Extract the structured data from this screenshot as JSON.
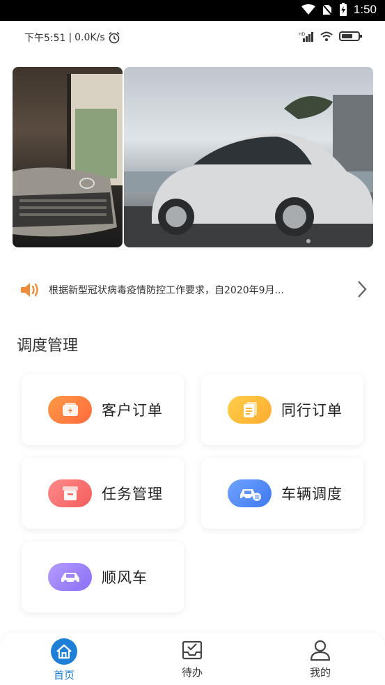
{
  "system_bar": {
    "time": "1:50"
  },
  "status_row": {
    "time_text": "下午5:51",
    "speed_text": "0.0K/s"
  },
  "notice": {
    "text": "根据新型冠状病毒疫情防控工作要求，自2020年9月..."
  },
  "section": {
    "title": "调度管理"
  },
  "cards": [
    {
      "label": "客户订单",
      "icon": "wallet-icon",
      "color_from": "#ff9a44",
      "color_to": "#ff6a3d"
    },
    {
      "label": "同行订单",
      "icon": "document-icon",
      "color_from": "#ffcf4a",
      "color_to": "#ffab2e"
    },
    {
      "label": "任务管理",
      "icon": "box-icon",
      "color_from": "#ff8a8a",
      "color_to": "#f25c5c"
    },
    {
      "label": "车辆调度",
      "icon": "car-dispatch-icon",
      "color_from": "#6fa3ff",
      "color_to": "#3f78f0"
    },
    {
      "label": "顺风车",
      "icon": "car-icon",
      "color_from": "#b49bff",
      "color_to": "#8a6ff5"
    }
  ],
  "bottom_nav": [
    {
      "label": "首页",
      "icon": "home-icon",
      "active": true
    },
    {
      "label": "待办",
      "icon": "todo-icon",
      "active": false
    },
    {
      "label": "我的",
      "icon": "profile-icon",
      "active": false
    }
  ],
  "colors": {
    "accent": "#1e7fd6",
    "notice_icon": "#f28c38"
  }
}
